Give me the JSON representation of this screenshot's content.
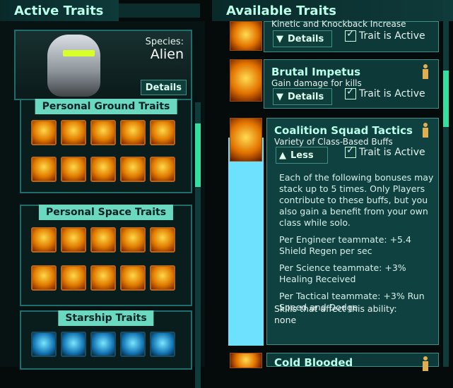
{
  "headers": {
    "active": "Active Traits",
    "available": "Available Traits"
  },
  "portrait": {
    "species_label": "Species:",
    "species_value": "Alien",
    "details_label": "Details"
  },
  "sections": {
    "ground": {
      "title": "Personal Ground Traits"
    },
    "space": {
      "title": "Personal Space Traits"
    },
    "starship": {
      "title": "Starship Traits"
    }
  },
  "cards": [
    {
      "title": "",
      "subtitle": "Kinetic and Knockback Increase",
      "button": "Details",
      "active_label": "Trait is Active"
    },
    {
      "title": "Brutal Impetus",
      "subtitle": "Gain damage for kills",
      "button": "Details",
      "active_label": "Trait is Active"
    },
    {
      "title": "Coalition Squad Tactics",
      "subtitle": "Variety of Class-Based Buffs",
      "button": "Less",
      "active_label": "Trait is Active",
      "desc": [
        "Each of the following bonuses may stack up to 5 times. Only Players contribute to these buffs, but you also gain a benefit from your own class while solo.",
        "Per Engineer teammate: +5.4 Shield Regen per sec",
        "Per Science teammate: +3% Healing Received",
        "Per Tactical teammate: +3% Run Speed and Dodge"
      ],
      "skills_label": "Skills that affect this ability:",
      "skills_value": "none"
    },
    {
      "title": "Cold Blooded"
    }
  ],
  "colors": {
    "accent": "#b9ffe9",
    "panel": "#0d3a39",
    "scroll": "#34e0a0",
    "highlight": "#6ee1ff"
  }
}
